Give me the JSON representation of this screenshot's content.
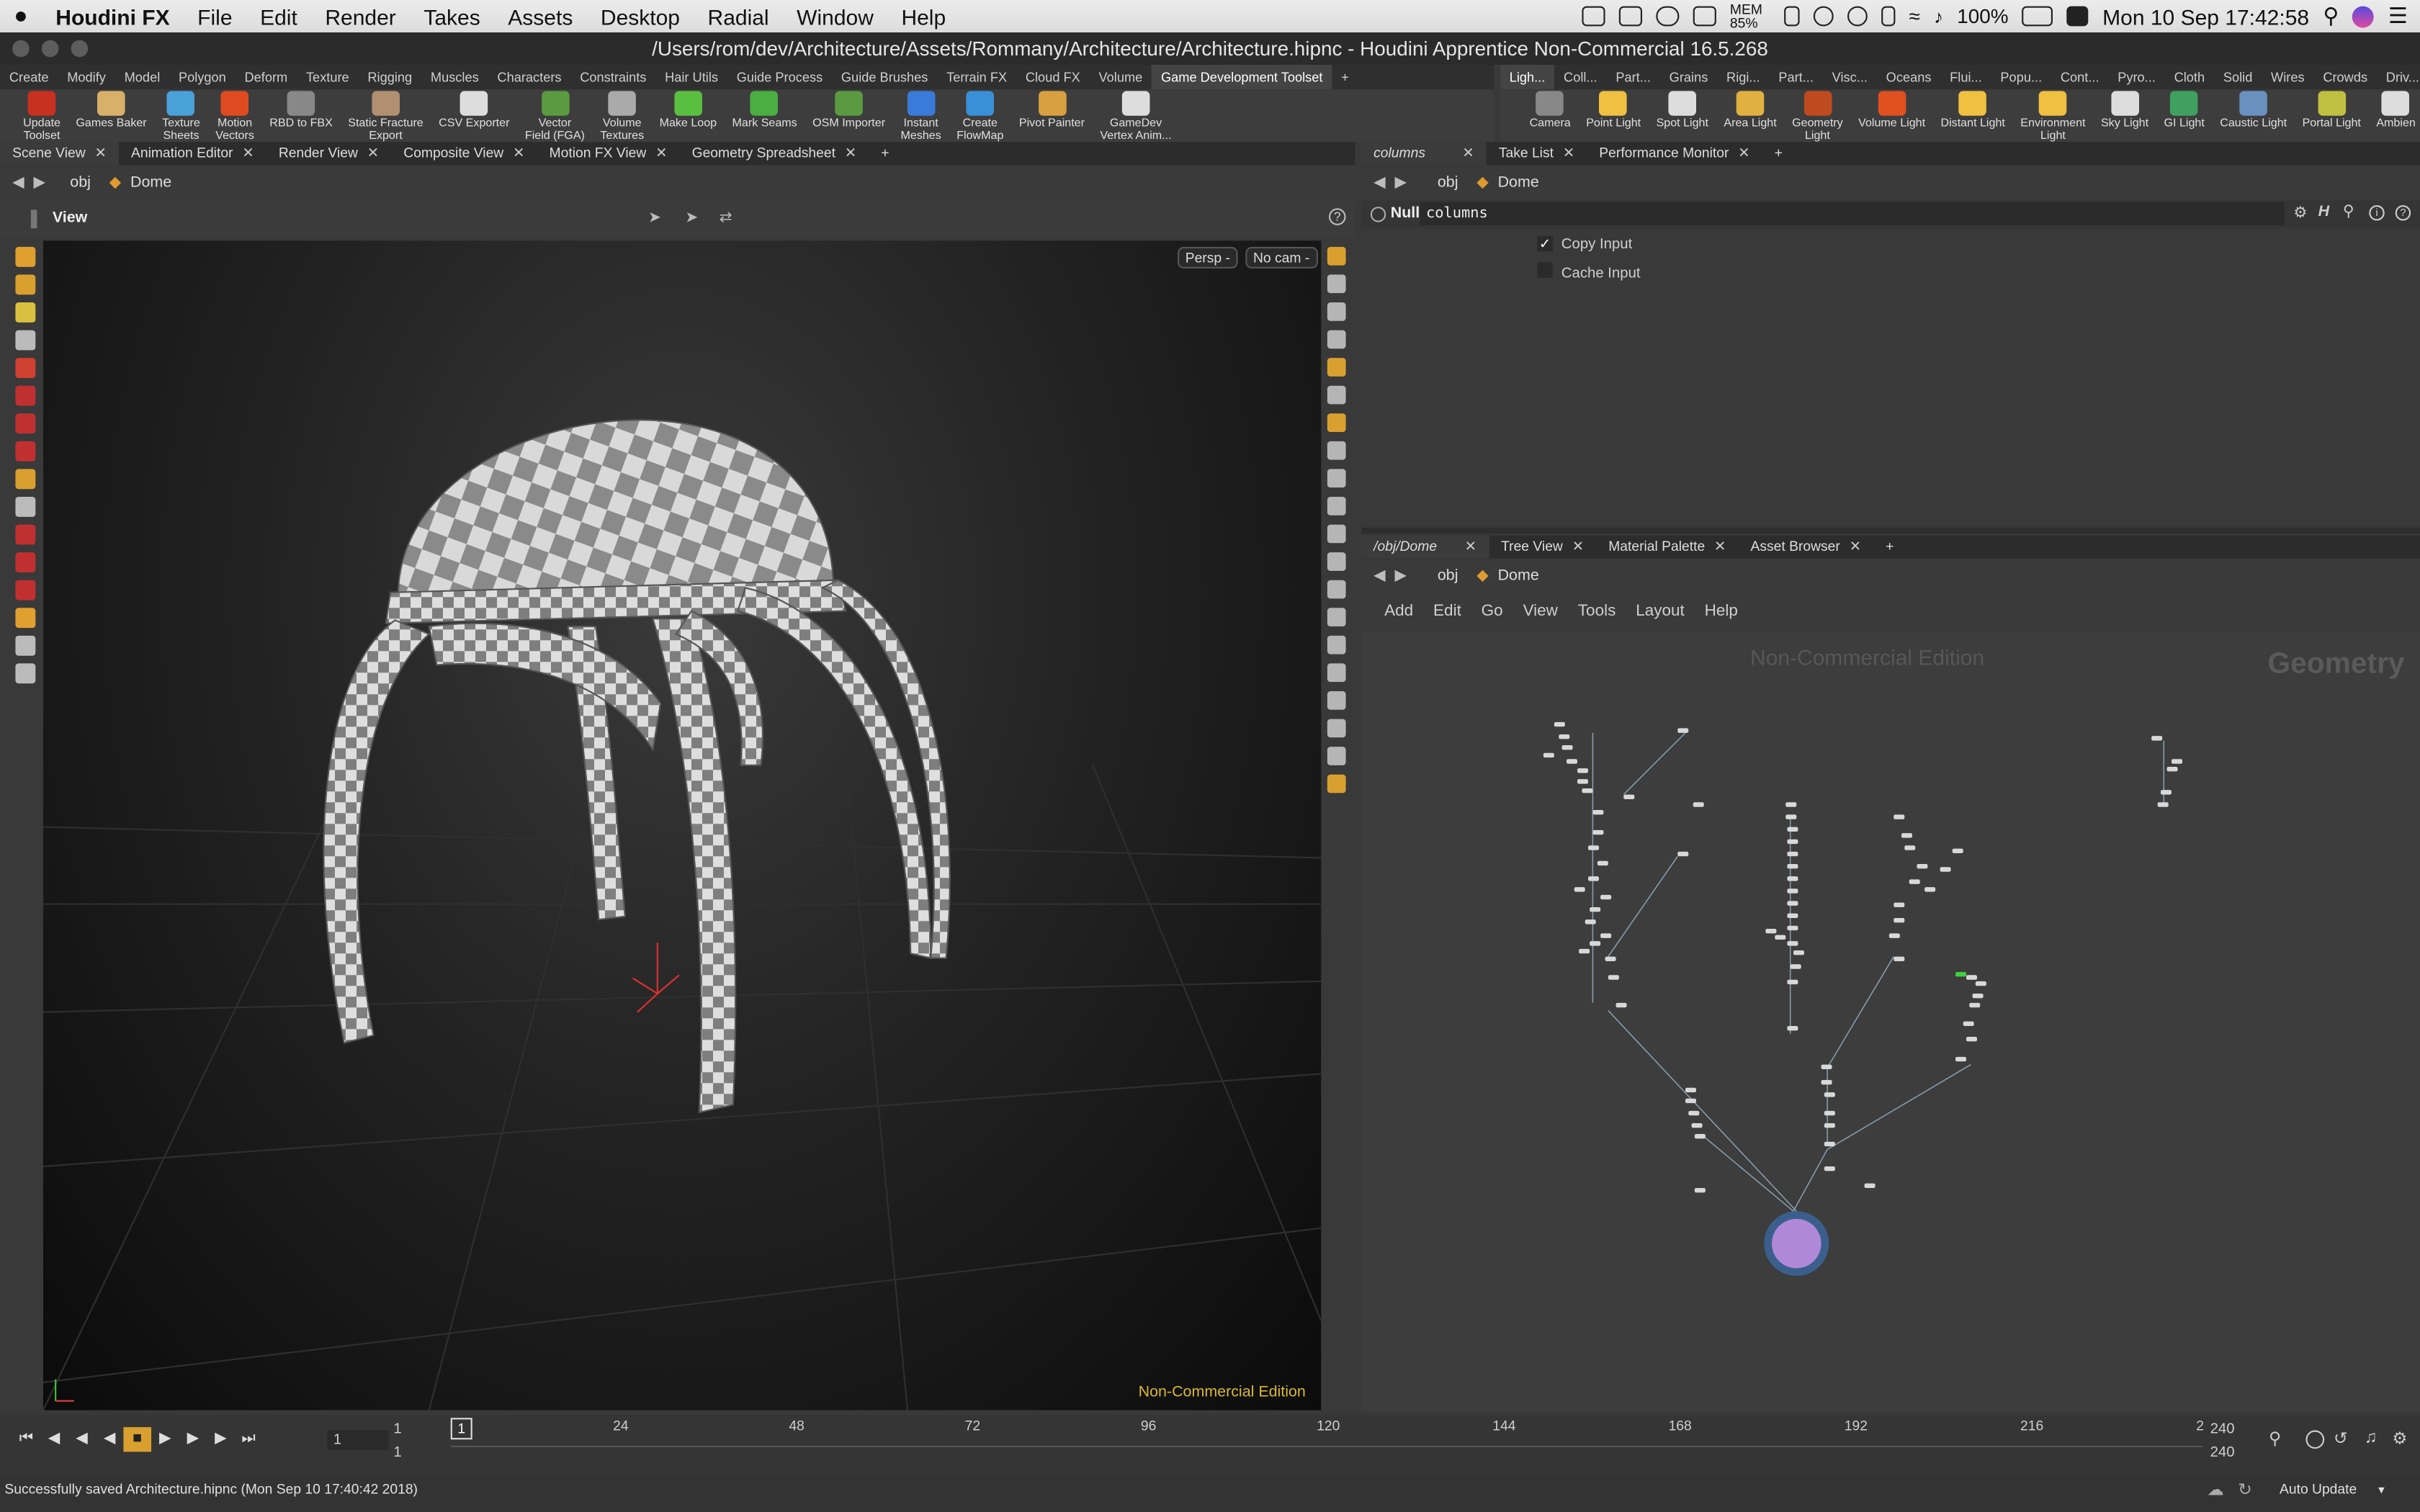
{
  "menubar": {
    "apple": "",
    "app_name": "Houdini FX",
    "items": [
      "File",
      "Edit",
      "Render",
      "Takes",
      "Assets",
      "Desktop",
      "Radial",
      "Window",
      "Help"
    ],
    "mem": "MEM 85%",
    "battery": "100%",
    "datetime": "Mon 10 Sep  17:42:58"
  },
  "window": {
    "title": "/Users/rom/dev/Architecture/Assets/Rommany/Architecture/Architecture.hipnc - Houdini Apprentice Non-Commercial 16.5.268"
  },
  "shelf_left": {
    "tabs": [
      "Create",
      "Modify",
      "Model",
      "Polygon",
      "Deform",
      "Texture",
      "Rigging",
      "Muscles",
      "Characters",
      "Constraints",
      "Hair Utils",
      "Guide Process",
      "Guide Brushes",
      "Terrain FX",
      "Cloud FX",
      "Volume",
      "Game Development Toolset",
      "+"
    ],
    "active_tab": "Game Development Toolset",
    "tools": [
      {
        "label": "Update\nToolset",
        "color": "#c83020"
      },
      {
        "label": "Games Baker",
        "color": "#d9b06a"
      },
      {
        "label": "Texture\nSheets",
        "color": "#4aa0d8"
      },
      {
        "label": "Motion\nVectors",
        "color": "#e04a20"
      },
      {
        "label": "RBD to FBX",
        "color": "#888888"
      },
      {
        "label": "Static Fracture\nExport",
        "color": "#b09070"
      },
      {
        "label": "CSV Exporter",
        "color": "#dddddd"
      },
      {
        "label": "Vector\nField (FGA)",
        "color": "#5a9a40"
      },
      {
        "label": "Volume\nTextures",
        "color": "#aaaaaa"
      },
      {
        "label": "Make Loop",
        "color": "#5abf40"
      },
      {
        "label": "Mark Seams",
        "color": "#4aaf40"
      },
      {
        "label": "OSM Importer",
        "color": "#5a9a40"
      },
      {
        "label": "Instant\nMeshes",
        "color": "#3a7ad8"
      },
      {
        "label": "Create\nFlowMap",
        "color": "#3a90d8"
      },
      {
        "label": "Pivot Painter",
        "color": "#d8a040"
      },
      {
        "label": "GameDev\nVertex Anim...",
        "color": "#dddddd"
      }
    ]
  },
  "shelf_right": {
    "tabs": [
      "Ligh...",
      "Coll...",
      "Part...",
      "Grains",
      "Rigi...",
      "Part...",
      "Visc...",
      "Oceans",
      "Flui...",
      "Popu...",
      "Cont...",
      "Pyro...",
      "Cloth",
      "Solid",
      "Wires",
      "Crowds",
      "Driv...",
      "+"
    ],
    "active_tab": "Ligh...",
    "tools": [
      {
        "label": "Camera",
        "color": "#888888"
      },
      {
        "label": "Point Light",
        "color": "#f0c040"
      },
      {
        "label": "Spot Light",
        "color": "#dddddd"
      },
      {
        "label": "Area Light",
        "color": "#e0b040"
      },
      {
        "label": "Geometry\nLight",
        "color": "#c04a20"
      },
      {
        "label": "Volume Light",
        "color": "#e05020"
      },
      {
        "label": "Distant Light",
        "color": "#f0c040"
      },
      {
        "label": "Environment\nLight",
        "color": "#f0c040"
      },
      {
        "label": "Sky Light",
        "color": "#dddddd"
      },
      {
        "label": "GI Light",
        "color": "#40a060"
      },
      {
        "label": "Caustic Light",
        "color": "#6a90c0"
      },
      {
        "label": "Portal Light",
        "color": "#c0c040"
      },
      {
        "label": "Ambien",
        "color": "#dddddd"
      }
    ]
  },
  "left_pane": {
    "tabs": [
      "Scene View",
      "Animation Editor",
      "Render View",
      "Composite View",
      "Motion FX View",
      "Geometry Spreadsheet",
      "+"
    ],
    "active_tab": "Scene View",
    "path": {
      "root": "obj",
      "node": "Dome"
    },
    "view_label": "View",
    "persp_btn": "Persp -",
    "cam_btn": "No cam -",
    "watermark": "Non-Commercial Edition"
  },
  "param_pane": {
    "tabs": [
      "columns",
      "Take List",
      "Performance Monitor",
      "+"
    ],
    "active_tab": "columns",
    "path": {
      "root": "obj",
      "node": "Dome"
    },
    "node_type": "Null",
    "node_name": "columns",
    "copy_input": "Copy Input",
    "cache_input": "Cache Input"
  },
  "network_pane": {
    "tabs": [
      "/obj/Dome",
      "Tree View",
      "Material Palette",
      "Asset Browser",
      "+"
    ],
    "active_tab": "/obj/Dome",
    "path": {
      "root": "obj",
      "node": "Dome"
    },
    "menu": [
      "Add",
      "Edit",
      "Go",
      "View",
      "Tools",
      "Layout",
      "Help"
    ],
    "watermark": "Non-Commercial Edition",
    "context_label": "Geometry"
  },
  "timeline": {
    "current_frame": "1",
    "start_frame": "1",
    "start_frame2": "1",
    "ticks": [
      "24",
      "48",
      "72",
      "96",
      "120",
      "144",
      "168",
      "192",
      "216",
      "2"
    ],
    "end_frame": "240",
    "end_frame2": "240"
  },
  "status": {
    "message": "Successfully saved Architecture.hipnc (Mon Sep 10 17:40:42 2018)",
    "auto_update": "Auto Update"
  }
}
